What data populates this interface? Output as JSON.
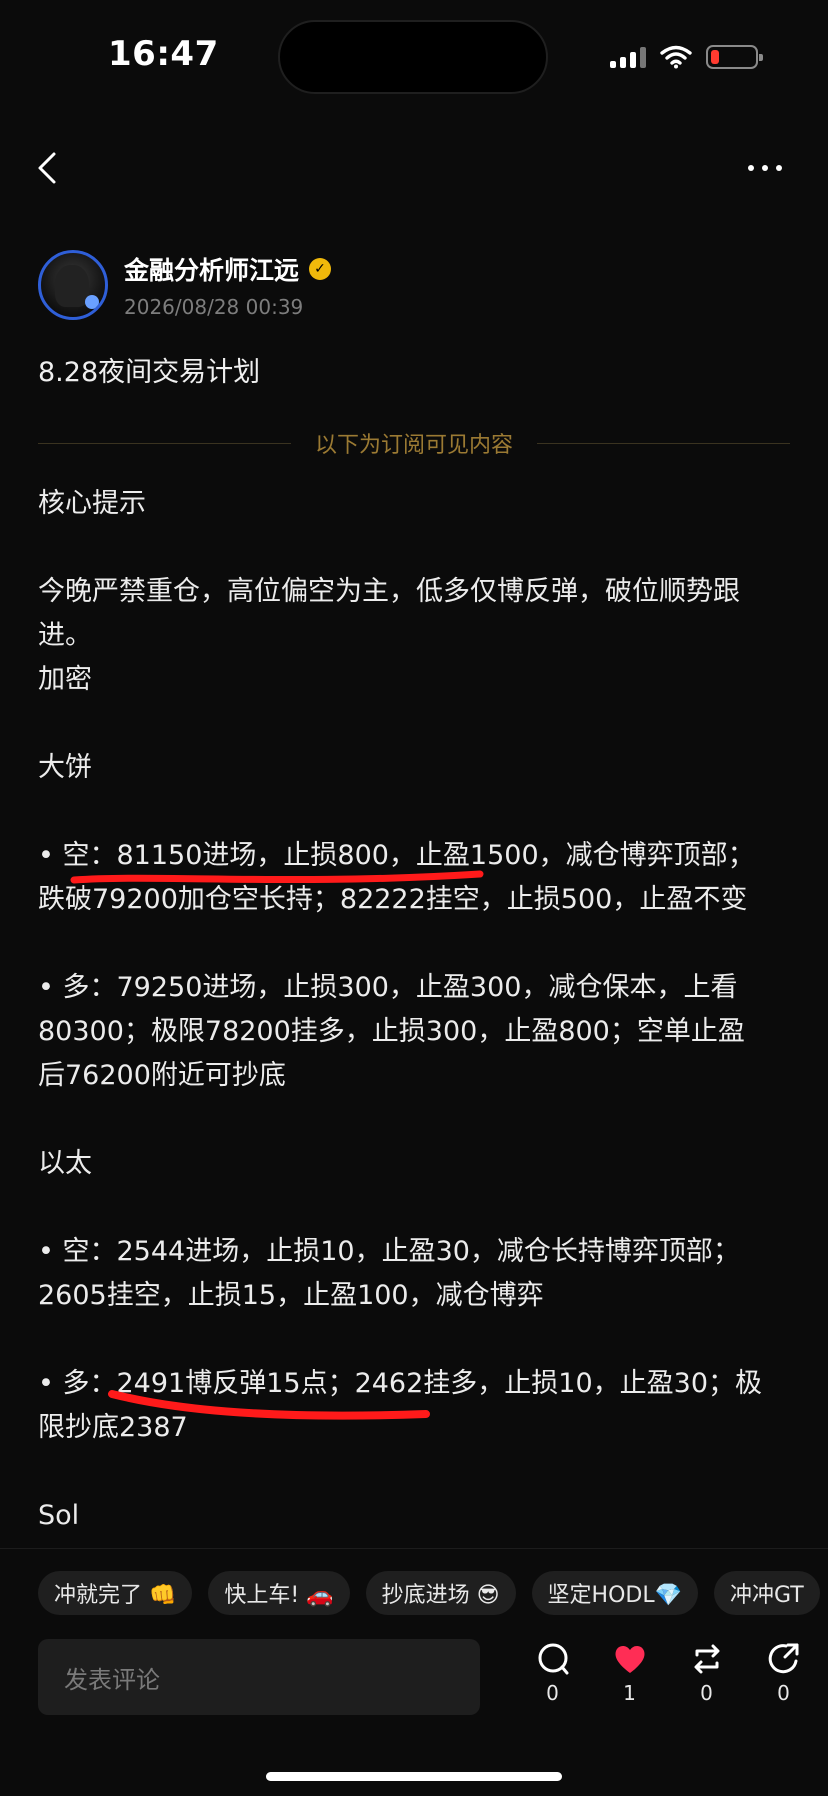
{
  "status_bar": {
    "time": "16:47"
  },
  "author": {
    "name": "金融分析师江远",
    "verified_icon": "verified-badge-icon",
    "date": "2026/08/28 00:39"
  },
  "post": {
    "title": "8.28夜间交易计划",
    "divider_label": "以下为订阅可见内容",
    "lines": {
      "core_tip": "核心提示",
      "core_body_1": "今晚严禁重仓，高位偏空为主，低多仅博反弹，破位顺势跟",
      "core_body_2": "进。",
      "crypto": "加密",
      "btc_heading": "大饼",
      "btc_short_1": "• 空：81150进场，止损800，止盈1500，减仓博弈顶部；",
      "btc_short_2": "跌破79200加仓空长持；82222挂空，止损500，止盈不变",
      "btc_long_1": "• 多：79250进场，止损300，止盈300，减仓保本，上看",
      "btc_long_2": "80300；极限78200挂多，止损300，止盈800；空单止盈",
      "btc_long_3": "后76200附近可抄底",
      "eth_heading": "以太",
      "eth_short_1": "• 空：2544进场，止损10，止盈30，减仓长持博弈顶部；",
      "eth_short_2": "2605挂空，止损15，止盈100，减仓博弈",
      "eth_long_1": "• 多：2491博反弹15点；2462挂多，止损10，止盈30；极",
      "eth_long_2": "限抄底2387",
      "sol_heading": "Sol"
    },
    "annotation_color": "#ff1a1a"
  },
  "reactions": [
    "冲就完了 👊",
    "快上车! 🚗",
    "抄底进场 😎",
    "坚定HODL💎",
    "冲冲GT"
  ],
  "comment": {
    "placeholder": "发表评论"
  },
  "actions": {
    "comment": {
      "icon": "comment-icon",
      "count": "0"
    },
    "like": {
      "icon": "heart-icon",
      "count": "1",
      "color": "#ff2d55"
    },
    "repost": {
      "icon": "repost-icon",
      "count": "0"
    },
    "share": {
      "icon": "share-icon",
      "count": "0"
    }
  }
}
